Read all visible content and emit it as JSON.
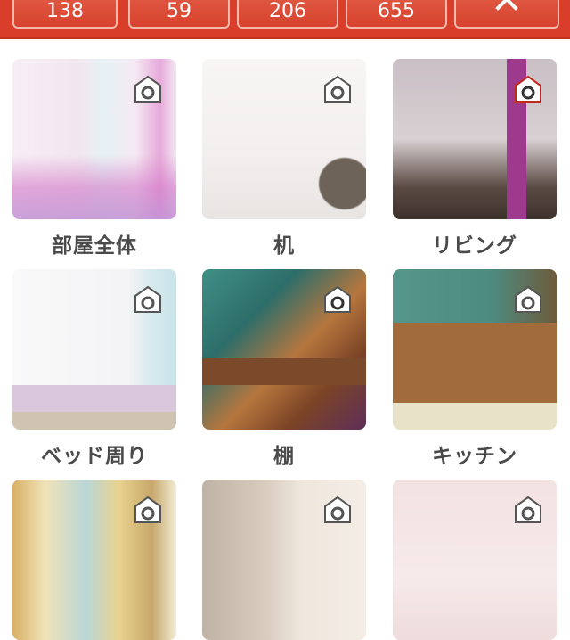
{
  "stats": [
    {
      "value": "138"
    },
    {
      "value": "59"
    },
    {
      "value": "206"
    },
    {
      "value": "655"
    }
  ],
  "collapse_icon": "chevron-up-icon",
  "rooms": [
    {
      "label": "部屋全体"
    },
    {
      "label": "机"
    },
    {
      "label": "リビング"
    },
    {
      "label": "ベッド周り"
    },
    {
      "label": "棚"
    },
    {
      "label": "キッチン"
    },
    {
      "label": ""
    },
    {
      "label": ""
    },
    {
      "label": ""
    }
  ],
  "photo_badge_icon": "camera-icon",
  "colors": {
    "header": "#d93e2a",
    "label": "#4a4a4a"
  }
}
